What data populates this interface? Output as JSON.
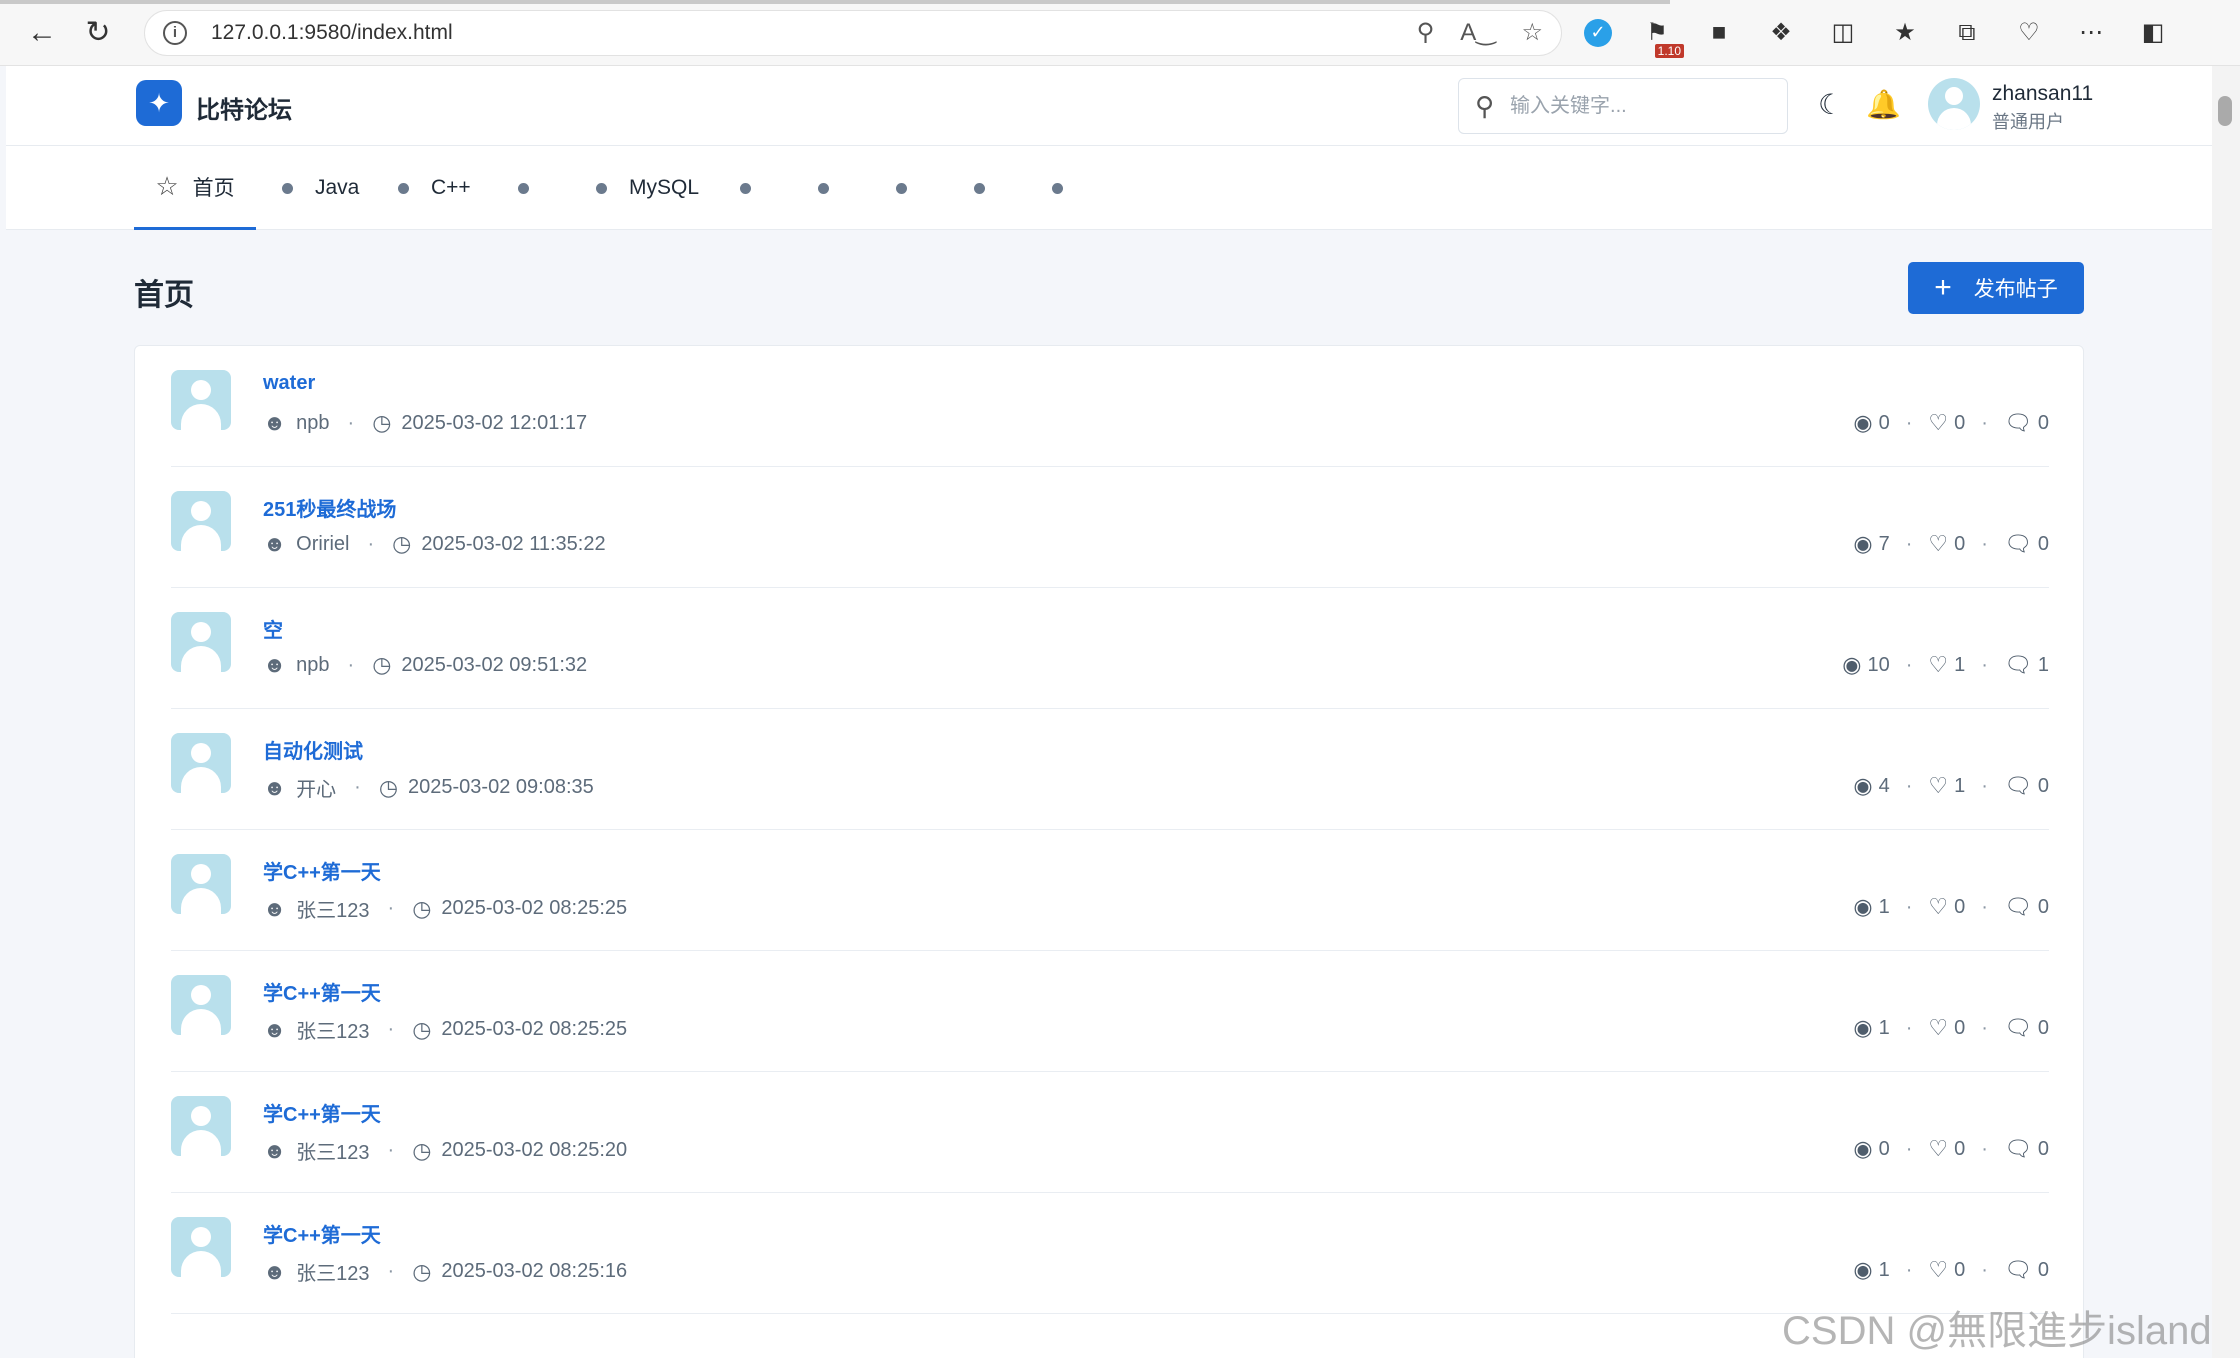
{
  "browser": {
    "url": "127.0.0.1:9580/index.html",
    "ext_badge": "1.10"
  },
  "header": {
    "brand": "比特论坛",
    "search_placeholder": "输入关键字...",
    "username": "zhansan11",
    "role": "普通用户"
  },
  "tabs": [
    {
      "label": "首页"
    },
    {
      "label": "Java"
    },
    {
      "label": "C++"
    },
    {
      "label": ""
    },
    {
      "label": "MySQL"
    },
    {
      "label": ""
    },
    {
      "label": ""
    },
    {
      "label": ""
    },
    {
      "label": ""
    },
    {
      "label": ""
    }
  ],
  "page": {
    "title": "首页",
    "post_button": "发布帖子"
  },
  "posts": [
    {
      "title": "water",
      "author": "npb",
      "time": "2025-03-02 12:01:17",
      "views": "0",
      "likes": "0",
      "replies": "0"
    },
    {
      "title": "251秒最终战场",
      "author": "Oririel",
      "time": "2025-03-02 11:35:22",
      "views": "7",
      "likes": "0",
      "replies": "0"
    },
    {
      "title": "空",
      "author": "npb",
      "time": "2025-03-02 09:51:32",
      "views": "10",
      "likes": "1",
      "replies": "1"
    },
    {
      "title": "自动化测试",
      "author": "开心",
      "time": "2025-03-02 09:08:35",
      "views": "4",
      "likes": "1",
      "replies": "0"
    },
    {
      "title": "学C++第一天",
      "author": "张三123",
      "time": "2025-03-02 08:25:25",
      "views": "1",
      "likes": "0",
      "replies": "0"
    },
    {
      "title": "学C++第一天",
      "author": "张三123",
      "time": "2025-03-02 08:25:25",
      "views": "1",
      "likes": "0",
      "replies": "0"
    },
    {
      "title": "学C++第一天",
      "author": "张三123",
      "time": "2025-03-02 08:25:20",
      "views": "0",
      "likes": "0",
      "replies": "0"
    },
    {
      "title": "学C++第一天",
      "author": "张三123",
      "time": "2025-03-02 08:25:16",
      "views": "1",
      "likes": "0",
      "replies": "0"
    }
  ],
  "watermark": "CSDN @無限進步island",
  "colors": {
    "accent": "#1e6bd6",
    "avatar": "#b9e0ec"
  }
}
